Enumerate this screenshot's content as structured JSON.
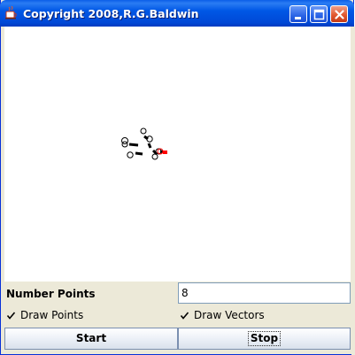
{
  "window": {
    "title": "Copyright 2008,R.G.Baldwin",
    "app_icon": "java-cup-icon",
    "buttons": [
      "minimize-icon",
      "maximize-icon",
      "close-icon"
    ]
  },
  "controls": {
    "number_points_label": "Number Points",
    "number_points_value": "8",
    "draw_points_label": "Draw Points",
    "draw_points_checked": true,
    "draw_vectors_label": "Draw Vectors",
    "draw_vectors_checked": true,
    "start_label": "Start",
    "stop_label": "Stop"
  },
  "colors": {
    "titlebar": "#0054e3",
    "highlight_point": "#ff0000"
  }
}
